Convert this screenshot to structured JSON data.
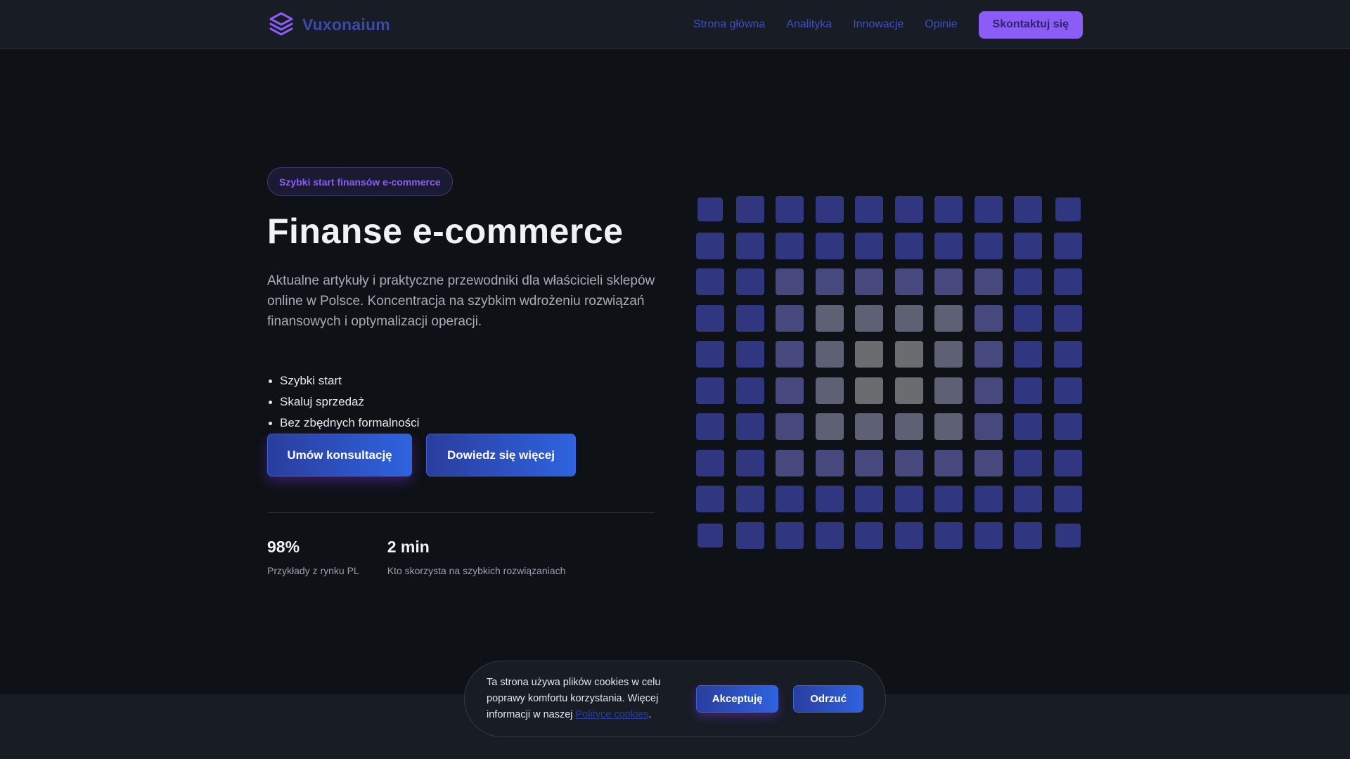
{
  "brand": {
    "name": "Vuxonaium",
    "logo_icon": "layers-icon",
    "logo_color": "#8b5cf6"
  },
  "nav": {
    "links": [
      "Strona główna",
      "Analityka",
      "Innowacje",
      "Opinie"
    ],
    "cta": "Skontaktuj się"
  },
  "hero": {
    "badge": "Szybki start finansów e-commerce",
    "title": "Finanse e-commerce",
    "description": "Aktualne artykuły i praktyczne przewodniki dla właścicieli sklepów online w Polsce. Koncentracja na szybkim wdrożeniu rozwiązań finansowych i optymalizacji operacji.",
    "features": [
      "Szybki start",
      "Skaluj sprzedaż",
      "Bez zbędnych formalności"
    ],
    "primary_button": "Umów konsultację",
    "secondary_button": "Dowiedz się więcej"
  },
  "stats": [
    {
      "value": "98%",
      "label": "Przykłady z rynku PL"
    },
    {
      "value": "2 min",
      "label": "Kto skorzysta na szybkich rozwiązaniach"
    }
  ],
  "grid": {
    "rows": 10,
    "cols": 10,
    "colors": {
      "outer": "#313680",
      "middle": "#46487e",
      "inner": "#5e6174",
      "core": "#6b6c70"
    }
  },
  "cookie": {
    "text_before": "Ta strona używa plików cookies w celu poprawy komfortu korzystania. Więcej informacji w naszej ",
    "link": "Polityce cookies",
    "text_after": ".",
    "accept": "Akceptuję",
    "reject": "Odrzuć"
  },
  "colors": {
    "accent": "#8b5cf6",
    "button_start": "#2a3d9e",
    "button_end": "#2f63df",
    "background": "#0e1116",
    "nav_link": "#3f4fbd"
  }
}
